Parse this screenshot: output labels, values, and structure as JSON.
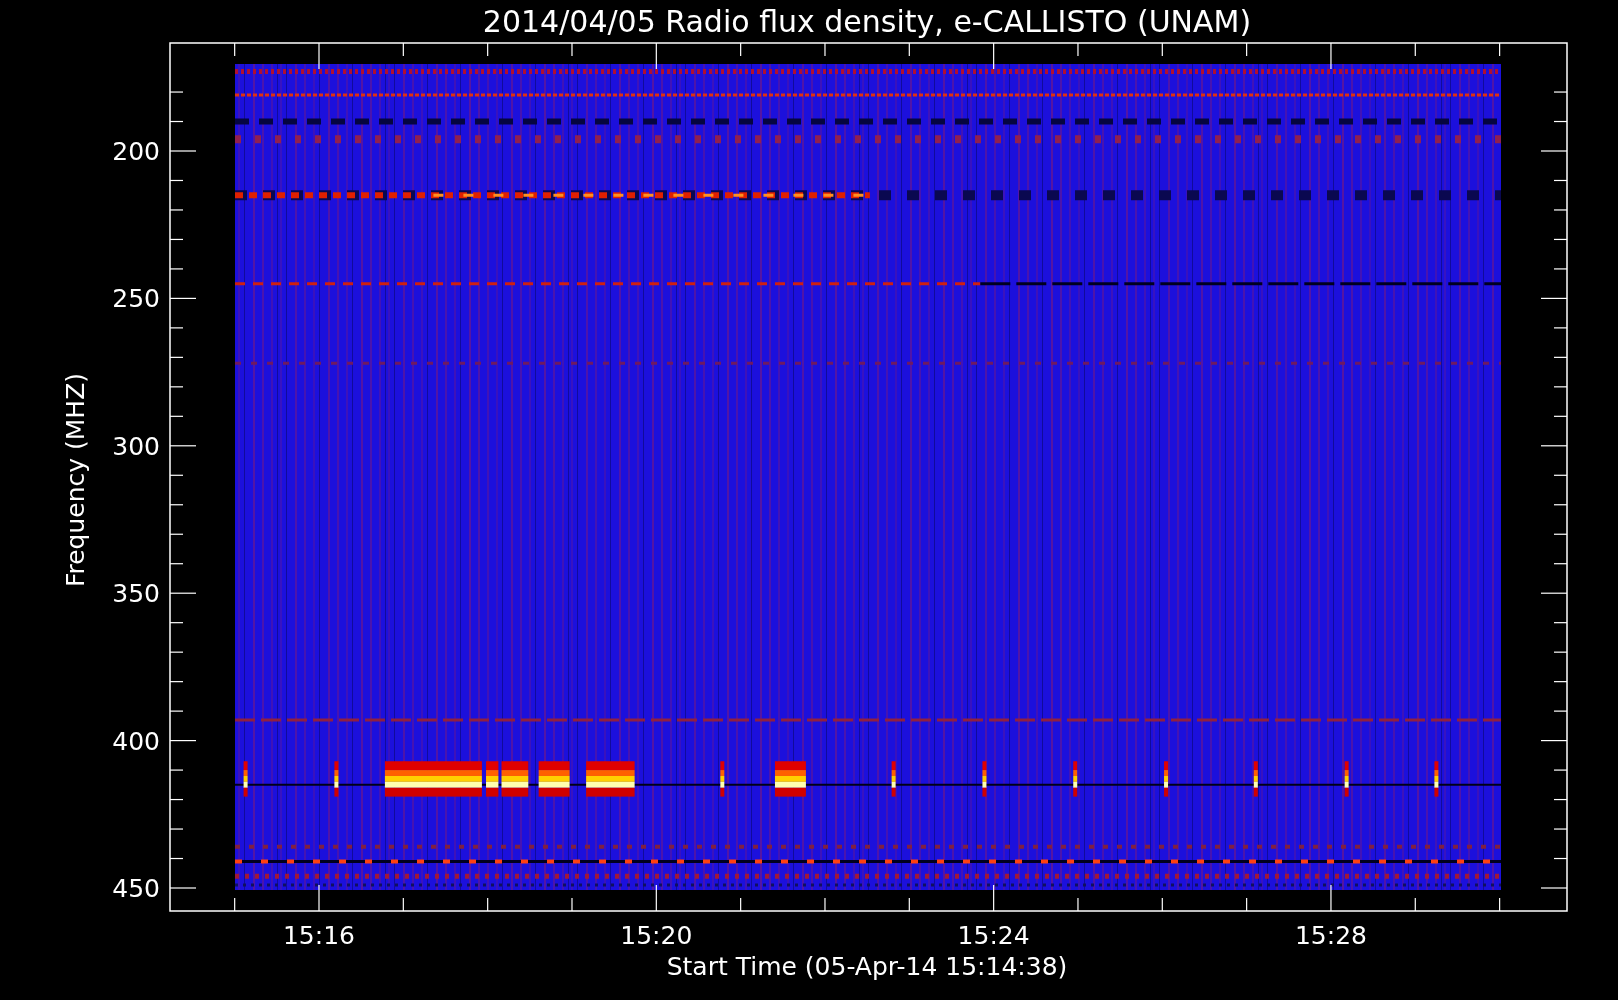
{
  "title": "2014/04/05  Radio flux density, e-CALLISTO (UNAM)",
  "ylabel": "Frequency (MHZ)",
  "xlabel": "Start Time (05-Apr-14 15:14:38)",
  "y_tick_labels": [
    "200",
    "250",
    "300",
    "350",
    "400",
    "450"
  ],
  "x_tick_labels": [
    "15:16",
    "15:20",
    "15:24",
    "15:28"
  ]
}
